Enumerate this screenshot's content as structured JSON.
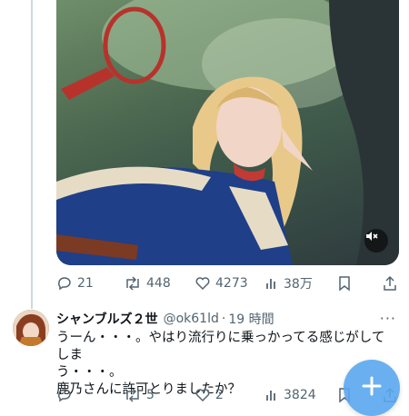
{
  "tweet": {
    "media": {
      "muted_icon": "volume-muted-icon"
    },
    "actions": {
      "replies": "21",
      "retweets": "448",
      "likes": "4273",
      "views": "38万"
    }
  },
  "reply": {
    "author_name": "シャンブルズ２世",
    "handle": "@ok61ld",
    "separator": "·",
    "time": "19 時間",
    "more": "···",
    "text_lines": [
      "うーん・・・。やはり流行りに乗っかってる感じがしてしま",
      "う・・・。",
      "鹿乃さんに許可とりましたか？"
    ],
    "actions": {
      "replies": "",
      "retweets": "5",
      "likes": "2",
      "views": "3824"
    }
  },
  "fab": {
    "icon": "plus-icon"
  },
  "colors": {
    "accent": "#1d9bf0",
    "muted_text": "#536471"
  }
}
